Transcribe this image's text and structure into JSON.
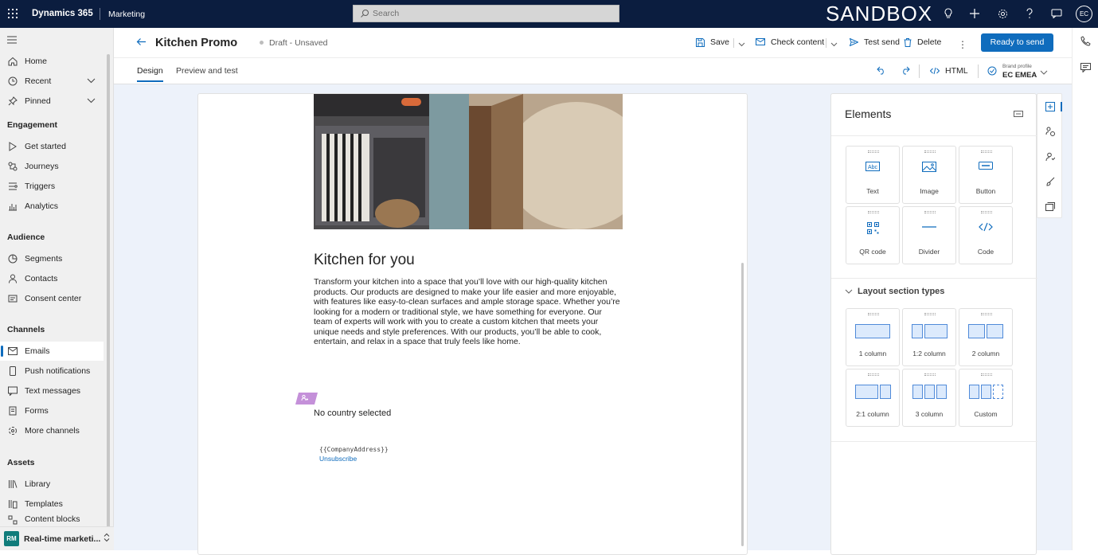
{
  "topbar": {
    "brand": "Dynamics 365",
    "app": "Marketing",
    "search_placeholder": "Search",
    "environment": "SANDBOX",
    "user_initials": "EC"
  },
  "nav": {
    "items_top": [
      {
        "label": "Home",
        "icon": "home-icon"
      },
      {
        "label": "Recent",
        "icon": "clock-icon"
      },
      {
        "label": "Pinned",
        "icon": "pin-icon"
      }
    ],
    "groups": [
      {
        "title": "Engagement",
        "items": [
          "Get started",
          "Journeys",
          "Triggers",
          "Analytics"
        ]
      },
      {
        "title": "Audience",
        "items": [
          "Segments",
          "Contacts",
          "Consent center"
        ]
      },
      {
        "title": "Channels",
        "items": [
          "Emails",
          "Push notifications",
          "Text messages",
          "Forms",
          "More channels"
        ]
      },
      {
        "title": "Assets",
        "items": [
          "Library",
          "Templates",
          "Content blocks"
        ]
      }
    ],
    "selected": "Emails",
    "area": {
      "initials": "RM",
      "label": "Real-time marketi..."
    }
  },
  "command": {
    "title": "Kitchen Promo",
    "status": "Draft - Unsaved",
    "save": "Save",
    "check_content": "Check content",
    "test_send": "Test send",
    "delete": "Delete",
    "ready": "Ready to send"
  },
  "tabs": {
    "design": "Design",
    "preview": "Preview and test",
    "html": "HTML",
    "brand_profile_label": "Brand profile",
    "brand_profile_value": "EC EMEA"
  },
  "email": {
    "heading": "Kitchen for you",
    "body": "Transform your kitchen into a space that you’ll love with our high-quality kitchen products. Our products are designed to make your life easier and more enjoyable, with features like easy-to-clean surfaces and ample storage space. Whether you’re looking for a modern or traditional style, we have something for everyone. Our team of experts will work with you to create a custom kitchen that meets your unique needs and style preferences. With our products, you’ll be able to cook, entertain, and relax in a space that truly feels like home.",
    "country": "No country selected",
    "address": "{{CompanyAddress}}",
    "unsubscribe": "Unsubscribe"
  },
  "panel": {
    "title": "Elements",
    "elements": [
      "Text",
      "Image",
      "Button",
      "QR code",
      "Divider",
      "Code"
    ],
    "layout_title": "Layout section types",
    "layouts": [
      "1 column",
      "1:2 column",
      "2 column",
      "2:1 column",
      "3 column",
      "Custom"
    ]
  },
  "colors": {
    "accent": "#0f6cbd",
    "topbar": "#0b1d3f",
    "canvas": "#edf2fa"
  }
}
